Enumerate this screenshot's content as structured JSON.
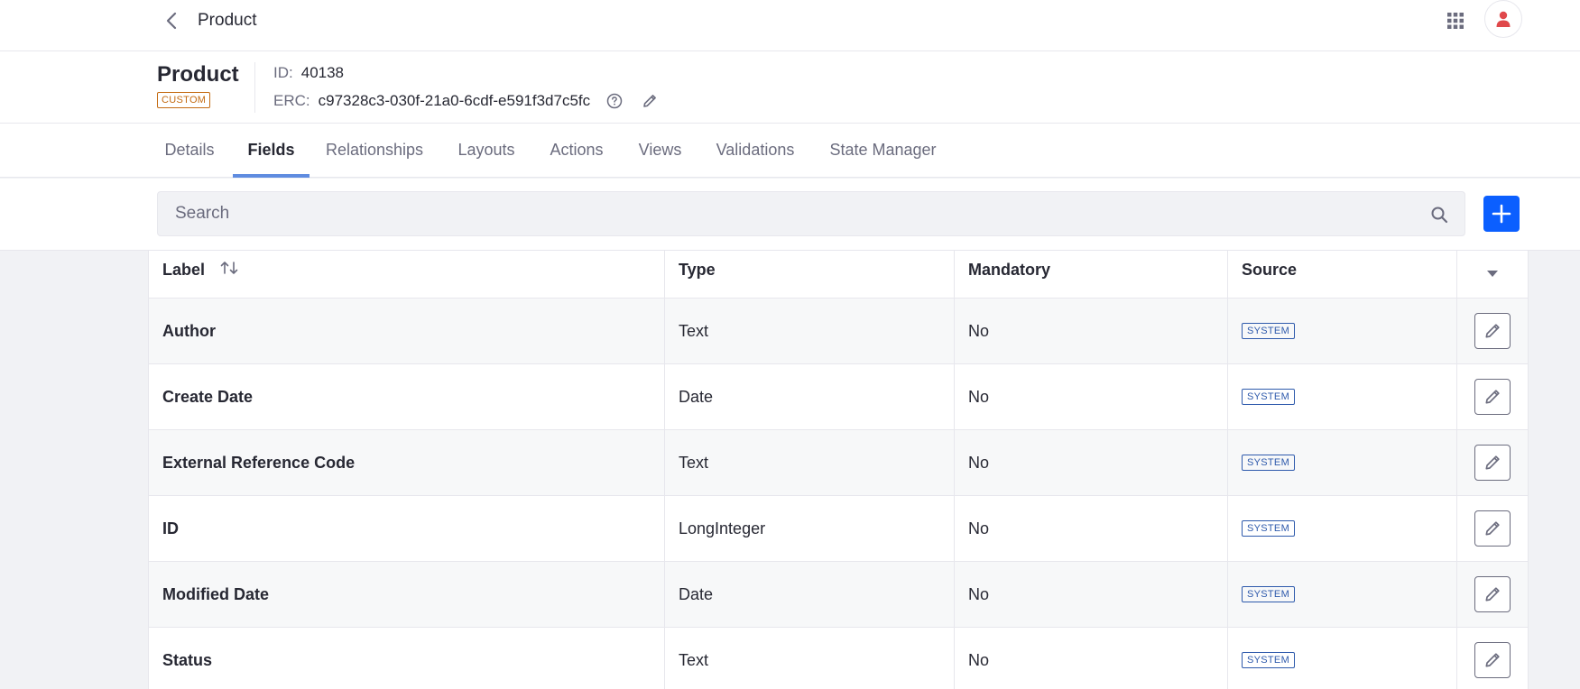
{
  "topbar": {
    "title": "Product",
    "back_icon": "chevron-left-icon",
    "apps_icon": "grid-icon",
    "user_icon": "user-icon"
  },
  "header": {
    "title": "Product",
    "badge": "CUSTOM",
    "id_label": "ID:",
    "id_value": "40138",
    "erc_label": "ERC:",
    "erc_value": "c97328c3-030f-21a0-6cdf-e591f3d7c5fc"
  },
  "tabs": [
    {
      "label": "Details"
    },
    {
      "label": "Fields",
      "active": true
    },
    {
      "label": "Relationships"
    },
    {
      "label": "Layouts"
    },
    {
      "label": "Actions"
    },
    {
      "label": "Views"
    },
    {
      "label": "Validations"
    },
    {
      "label": "State Manager"
    }
  ],
  "search": {
    "placeholder": "Search",
    "value": ""
  },
  "table": {
    "columns": [
      "Label",
      "Type",
      "Mandatory",
      "Source"
    ],
    "rows": [
      {
        "label": "Author",
        "type": "Text",
        "mandatory": "No",
        "source": "SYSTEM"
      },
      {
        "label": "Create Date",
        "type": "Date",
        "mandatory": "No",
        "source": "SYSTEM"
      },
      {
        "label": "External Reference Code",
        "type": "Text",
        "mandatory": "No",
        "source": "SYSTEM"
      },
      {
        "label": "ID",
        "type": "LongInteger",
        "mandatory": "No",
        "source": "SYSTEM"
      },
      {
        "label": "Modified Date",
        "type": "Date",
        "mandatory": "No",
        "source": "SYSTEM"
      },
      {
        "label": "Status",
        "type": "Text",
        "mandatory": "No",
        "source": "SYSTEM"
      }
    ]
  },
  "colors": {
    "primary": "#0b5fff",
    "tab_indicator": "#5f8ce0",
    "custom_badge": "#c46b12",
    "system_badge": "#2e5aac",
    "avatar": "#e0484b"
  }
}
